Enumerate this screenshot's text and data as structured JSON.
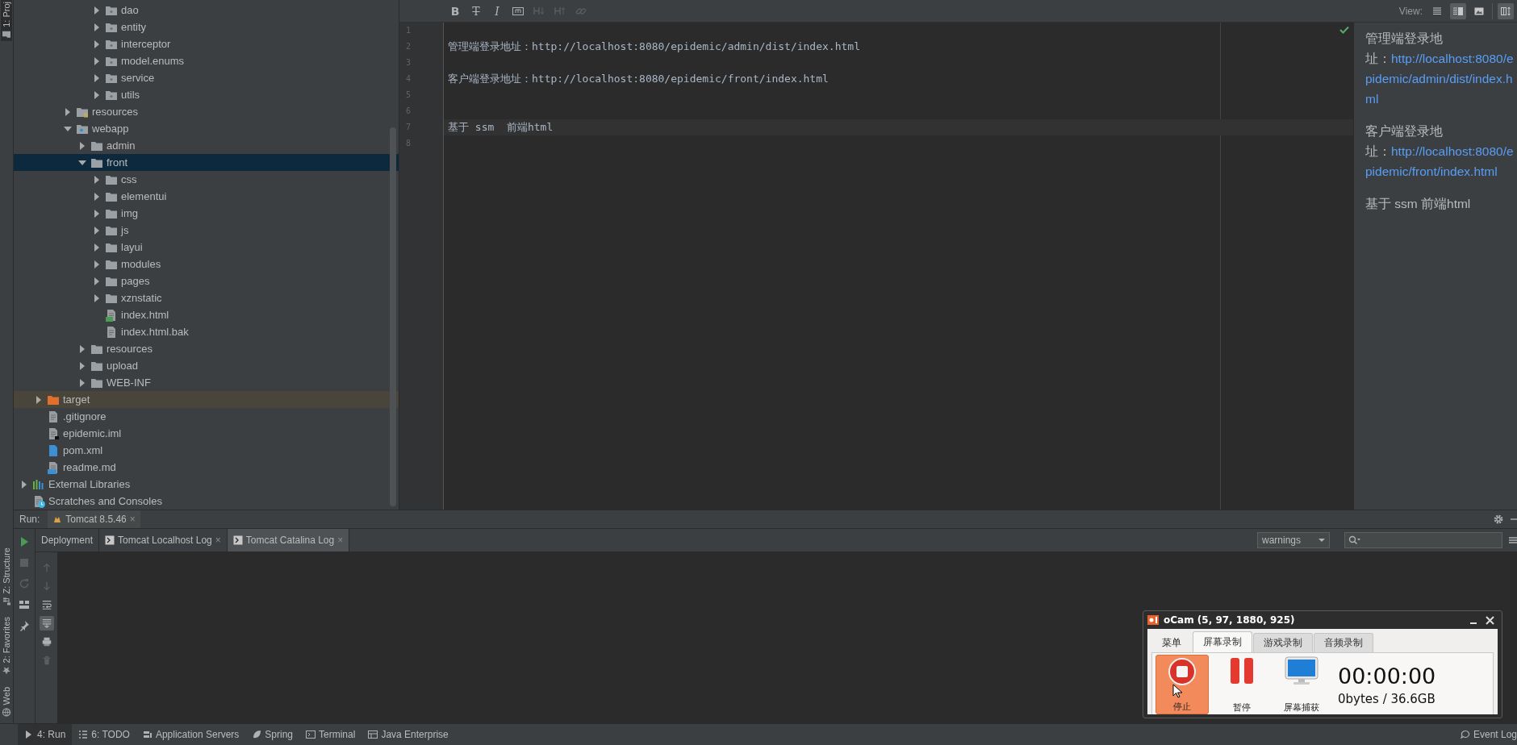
{
  "side_tabs": [
    {
      "label": "1: Proj",
      "kind": "project",
      "selected": true
    },
    {
      "label": "Z: Structure",
      "kind": "structure",
      "selected": false
    },
    {
      "label": "2: Favorites",
      "kind": "favorites",
      "selected": false
    },
    {
      "label": "Web",
      "kind": "web",
      "selected": false
    }
  ],
  "project_tree": {
    "items": [
      {
        "children": [
          {
            "children": [
              {
                "children": [
                  {
                    "children": [
                      {
                        "children": [
                          {
                            "label": "dao",
                            "kind": "package",
                            "expanded": false,
                            "selected": false
                          },
                          {
                            "label": "entity",
                            "kind": "package",
                            "expanded": false,
                            "selected": false
                          },
                          {
                            "label": "interceptor",
                            "kind": "package",
                            "expanded": false,
                            "selected": false
                          },
                          {
                            "label": "model.enums",
                            "kind": "package",
                            "expanded": false,
                            "selected": false
                          },
                          {
                            "label": "service",
                            "kind": "package",
                            "expanded": false,
                            "selected": false
                          },
                          {
                            "label": "utils",
                            "kind": "package",
                            "expanded": false,
                            "selected": false
                          }
                        ]
                      }
                    ]
                  },
                  {
                    "label": "resources",
                    "kind": "resources_folder",
                    "expanded": false,
                    "selected": false
                  },
                  {
                    "label": "webapp",
                    "kind": "web_folder",
                    "expanded": true,
                    "selected": false,
                    "children": [
                      {
                        "label": "admin",
                        "kind": "folder",
                        "expanded": false,
                        "selected": false
                      },
                      {
                        "label": "front",
                        "kind": "folder",
                        "expanded": true,
                        "selected": true,
                        "children": [
                          {
                            "label": "css",
                            "kind": "folder",
                            "expanded": false,
                            "selected": false
                          },
                          {
                            "label": "elementui",
                            "kind": "folder",
                            "expanded": false,
                            "selected": false
                          },
                          {
                            "label": "img",
                            "kind": "folder",
                            "expanded": false,
                            "selected": false
                          },
                          {
                            "label": "js",
                            "kind": "folder",
                            "expanded": false,
                            "selected": false
                          },
                          {
                            "label": "layui",
                            "kind": "folder",
                            "expanded": false,
                            "selected": false
                          },
                          {
                            "label": "modules",
                            "kind": "folder",
                            "expanded": false,
                            "selected": false
                          },
                          {
                            "label": "pages",
                            "kind": "folder",
                            "expanded": false,
                            "selected": false
                          },
                          {
                            "label": "xznstatic",
                            "kind": "folder",
                            "expanded": false,
                            "selected": false
                          },
                          {
                            "label": "index.html",
                            "kind": "html_file",
                            "selected": false
                          },
                          {
                            "label": "index.html.bak",
                            "kind": "text_file",
                            "selected": false
                          }
                        ]
                      },
                      {
                        "label": "resources",
                        "kind": "folder",
                        "expanded": false,
                        "selected": false
                      },
                      {
                        "label": "upload",
                        "kind": "folder",
                        "expanded": false,
                        "selected": false
                      },
                      {
                        "label": "WEB-INF",
                        "kind": "folder",
                        "expanded": false,
                        "selected": false
                      }
                    ]
                  }
                ]
              }
            ]
          },
          {
            "label": "target",
            "kind": "excluded_folder",
            "expanded": false,
            "selected": false
          },
          {
            "label": ".gitignore",
            "kind": "text_file",
            "selected": false
          },
          {
            "label": "epidemic.iml",
            "kind": "iml_file",
            "selected": false
          },
          {
            "label": "pom.xml",
            "kind": "maven_file",
            "selected": false
          },
          {
            "label": "readme.md",
            "kind": "markdown_file",
            "selected": false
          }
        ]
      },
      {
        "label": "External Libraries",
        "kind": "libraries",
        "expanded": false,
        "selected": false
      },
      {
        "label": "Scratches and Consoles",
        "kind": "scratches",
        "selected": false
      }
    ]
  },
  "editor": {
    "toolbar": [
      {
        "kind": "bold",
        "label": "B",
        "disabled": false
      },
      {
        "kind": "strike",
        "label": "T",
        "disabled": false
      },
      {
        "kind": "italic",
        "label": "I",
        "disabled": false
      },
      {
        "kind": "code",
        "disabled": false
      },
      {
        "kind": "heading_down",
        "disabled": true
      },
      {
        "kind": "heading_up",
        "disabled": true
      },
      {
        "kind": "link",
        "disabled": true
      }
    ],
    "lines": [
      {
        "number": "1",
        "current": false
      },
      {
        "number": "2",
        "text": "管理端登录地址：http://localhost:8080/epidemic/admin/dist/index.html",
        "current": false
      },
      {
        "number": "3",
        "current": false
      },
      {
        "number": "4",
        "text": "客户端登录地址：http://localhost:8080/epidemic/front/index.html",
        "current": false
      },
      {
        "number": "5",
        "current": false
      },
      {
        "number": "6",
        "current": false
      },
      {
        "number": "7",
        "text": "基于 ssm  前端html",
        "current": true
      },
      {
        "number": "8",
        "current": false
      }
    ]
  },
  "preview": {
    "view_label": "View:",
    "view_modes": [
      {
        "kind": "editor_only",
        "selected": false
      },
      {
        "kind": "split",
        "selected": true
      },
      {
        "kind": "preview_only",
        "selected": false
      },
      {
        "kind": "layout",
        "selected": true
      }
    ],
    "paragraphs": [
      {
        "lines": [
          [
            {
              "text": "管理端登录地"
            }
          ],
          [
            {
              "text": "址："
            },
            {
              "link": "http://localhost:8080/e"
            }
          ],
          [
            {
              "link": "pidemic/admin/dist/index.h"
            }
          ],
          [
            {
              "link": "ml"
            }
          ]
        ]
      },
      {
        "lines": [
          [
            {
              "text": "客户端登录地"
            }
          ],
          [
            {
              "text": "址："
            },
            {
              "link": "http://localhost:8080/e"
            }
          ],
          [
            {
              "link": "pidemic/front/index.html"
            }
          ]
        ]
      },
      {
        "lines": [
          [
            {
              "text": "基于 ssm 前端html"
            }
          ]
        ]
      }
    ]
  },
  "run_panel": {
    "label": "Run:",
    "config_tab": {
      "label": "Tomcat 8.5.46",
      "close": "×"
    },
    "left_toolbar": [
      {
        "kind": "run",
        "disabled": false
      },
      {
        "kind": "stop",
        "disabled": true
      },
      {
        "kind": "rerun",
        "disabled": true
      },
      {
        "kind": "layout",
        "disabled": false
      },
      {
        "kind": "pin",
        "disabled": false
      }
    ],
    "tabs": [
      {
        "label": "Deployment",
        "kind": "plain",
        "selected": false
      },
      {
        "label": "Tomcat Localhost Log",
        "kind": "log",
        "close": "×",
        "selected": false
      },
      {
        "label": "Tomcat Catalina Log",
        "kind": "log",
        "close": "×",
        "selected": true
      }
    ],
    "filter": {
      "value": "warnings"
    },
    "console_toolbar": [
      {
        "kind": "up",
        "disabled": true,
        "on": false
      },
      {
        "kind": "down",
        "disabled": true,
        "on": false
      },
      {
        "kind": "wrap",
        "disabled": false,
        "on": false
      },
      {
        "kind": "scroll_end",
        "disabled": false,
        "on": true
      },
      {
        "kind": "print",
        "disabled": false,
        "on": false
      },
      {
        "kind": "trash",
        "disabled": true,
        "on": false
      }
    ]
  },
  "status_bar": {
    "items": [
      {
        "label": "4: Run",
        "kind": "run",
        "selected": true
      },
      {
        "label": "6: TODO",
        "kind": "todo",
        "selected": false
      },
      {
        "label": "Application Servers",
        "kind": "servers",
        "selected": false
      },
      {
        "label": "Spring",
        "kind": "spring",
        "selected": false
      },
      {
        "label": "Terminal",
        "kind": "terminal",
        "selected": false
      },
      {
        "label": "Java Enterprise",
        "kind": "enterprise",
        "selected": false
      }
    ],
    "event_log": "Event Log"
  },
  "ocam": {
    "title": "oCam (5, 97, 1880, 925)",
    "tabs": [
      {
        "label": "菜单",
        "kind": "menu",
        "selected": false
      },
      {
        "label": "屏幕录制",
        "kind": "tab",
        "selected": true
      },
      {
        "label": "游戏录制",
        "kind": "tab",
        "selected": false
      },
      {
        "label": "音频录制",
        "kind": "tab",
        "selected": false
      }
    ],
    "buttons": [
      {
        "kind": "stop",
        "label": "停止",
        "active": true
      },
      {
        "kind": "pause",
        "label": "暂停",
        "active": false
      },
      {
        "kind": "capture",
        "label": "屏幕捕获",
        "active": false
      }
    ],
    "time": "00:00:00",
    "size": "0bytes / 36.6GB"
  }
}
